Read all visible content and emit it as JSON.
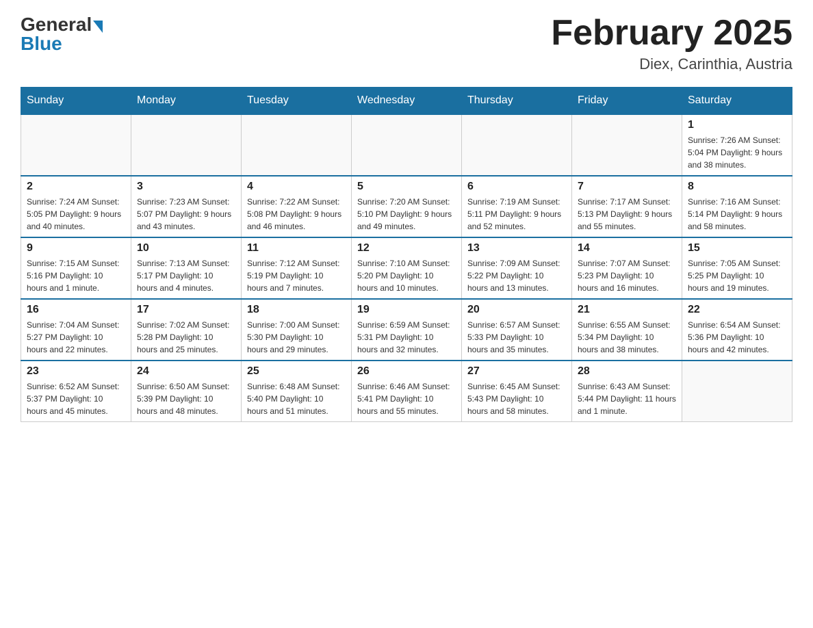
{
  "logo": {
    "general": "General",
    "blue": "Blue"
  },
  "title": "February 2025",
  "location": "Diex, Carinthia, Austria",
  "days_of_week": [
    "Sunday",
    "Monday",
    "Tuesday",
    "Wednesday",
    "Thursday",
    "Friday",
    "Saturday"
  ],
  "weeks": [
    [
      {
        "day": "",
        "info": ""
      },
      {
        "day": "",
        "info": ""
      },
      {
        "day": "",
        "info": ""
      },
      {
        "day": "",
        "info": ""
      },
      {
        "day": "",
        "info": ""
      },
      {
        "day": "",
        "info": ""
      },
      {
        "day": "1",
        "info": "Sunrise: 7:26 AM\nSunset: 5:04 PM\nDaylight: 9 hours and 38 minutes."
      }
    ],
    [
      {
        "day": "2",
        "info": "Sunrise: 7:24 AM\nSunset: 5:05 PM\nDaylight: 9 hours and 40 minutes."
      },
      {
        "day": "3",
        "info": "Sunrise: 7:23 AM\nSunset: 5:07 PM\nDaylight: 9 hours and 43 minutes."
      },
      {
        "day": "4",
        "info": "Sunrise: 7:22 AM\nSunset: 5:08 PM\nDaylight: 9 hours and 46 minutes."
      },
      {
        "day": "5",
        "info": "Sunrise: 7:20 AM\nSunset: 5:10 PM\nDaylight: 9 hours and 49 minutes."
      },
      {
        "day": "6",
        "info": "Sunrise: 7:19 AM\nSunset: 5:11 PM\nDaylight: 9 hours and 52 minutes."
      },
      {
        "day": "7",
        "info": "Sunrise: 7:17 AM\nSunset: 5:13 PM\nDaylight: 9 hours and 55 minutes."
      },
      {
        "day": "8",
        "info": "Sunrise: 7:16 AM\nSunset: 5:14 PM\nDaylight: 9 hours and 58 minutes."
      }
    ],
    [
      {
        "day": "9",
        "info": "Sunrise: 7:15 AM\nSunset: 5:16 PM\nDaylight: 10 hours and 1 minute."
      },
      {
        "day": "10",
        "info": "Sunrise: 7:13 AM\nSunset: 5:17 PM\nDaylight: 10 hours and 4 minutes."
      },
      {
        "day": "11",
        "info": "Sunrise: 7:12 AM\nSunset: 5:19 PM\nDaylight: 10 hours and 7 minutes."
      },
      {
        "day": "12",
        "info": "Sunrise: 7:10 AM\nSunset: 5:20 PM\nDaylight: 10 hours and 10 minutes."
      },
      {
        "day": "13",
        "info": "Sunrise: 7:09 AM\nSunset: 5:22 PM\nDaylight: 10 hours and 13 minutes."
      },
      {
        "day": "14",
        "info": "Sunrise: 7:07 AM\nSunset: 5:23 PM\nDaylight: 10 hours and 16 minutes."
      },
      {
        "day": "15",
        "info": "Sunrise: 7:05 AM\nSunset: 5:25 PM\nDaylight: 10 hours and 19 minutes."
      }
    ],
    [
      {
        "day": "16",
        "info": "Sunrise: 7:04 AM\nSunset: 5:27 PM\nDaylight: 10 hours and 22 minutes."
      },
      {
        "day": "17",
        "info": "Sunrise: 7:02 AM\nSunset: 5:28 PM\nDaylight: 10 hours and 25 minutes."
      },
      {
        "day": "18",
        "info": "Sunrise: 7:00 AM\nSunset: 5:30 PM\nDaylight: 10 hours and 29 minutes."
      },
      {
        "day": "19",
        "info": "Sunrise: 6:59 AM\nSunset: 5:31 PM\nDaylight: 10 hours and 32 minutes."
      },
      {
        "day": "20",
        "info": "Sunrise: 6:57 AM\nSunset: 5:33 PM\nDaylight: 10 hours and 35 minutes."
      },
      {
        "day": "21",
        "info": "Sunrise: 6:55 AM\nSunset: 5:34 PM\nDaylight: 10 hours and 38 minutes."
      },
      {
        "day": "22",
        "info": "Sunrise: 6:54 AM\nSunset: 5:36 PM\nDaylight: 10 hours and 42 minutes."
      }
    ],
    [
      {
        "day": "23",
        "info": "Sunrise: 6:52 AM\nSunset: 5:37 PM\nDaylight: 10 hours and 45 minutes."
      },
      {
        "day": "24",
        "info": "Sunrise: 6:50 AM\nSunset: 5:39 PM\nDaylight: 10 hours and 48 minutes."
      },
      {
        "day": "25",
        "info": "Sunrise: 6:48 AM\nSunset: 5:40 PM\nDaylight: 10 hours and 51 minutes."
      },
      {
        "day": "26",
        "info": "Sunrise: 6:46 AM\nSunset: 5:41 PM\nDaylight: 10 hours and 55 minutes."
      },
      {
        "day": "27",
        "info": "Sunrise: 6:45 AM\nSunset: 5:43 PM\nDaylight: 10 hours and 58 minutes."
      },
      {
        "day": "28",
        "info": "Sunrise: 6:43 AM\nSunset: 5:44 PM\nDaylight: 11 hours and 1 minute."
      },
      {
        "day": "",
        "info": ""
      }
    ]
  ]
}
